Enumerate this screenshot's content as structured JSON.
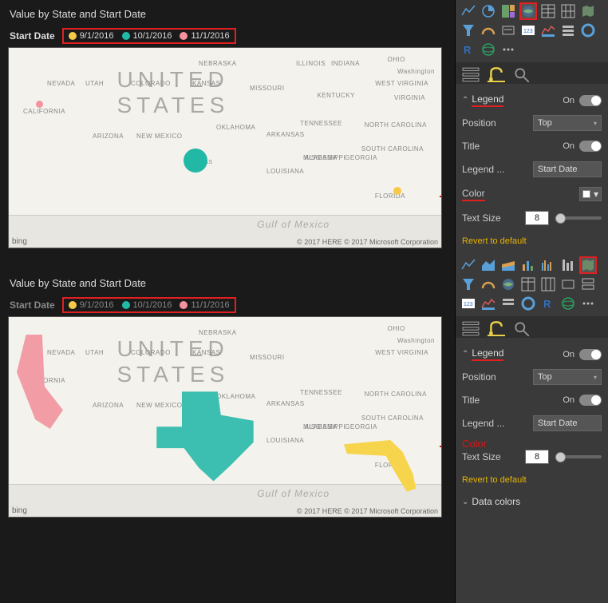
{
  "visual1": {
    "title": "Value by State and Start Date",
    "legend_label": "Start Date",
    "legend_items": [
      {
        "color": "#f7c948",
        "text": "9/1/2016"
      },
      {
        "color": "#22b8a6",
        "text": "10/1/2016"
      },
      {
        "color": "#f5929e",
        "text": "11/1/2016"
      }
    ],
    "map_label": "UNITED STATES",
    "gulf": "Gulf of Mexico",
    "bing": "bing",
    "attrib": "© 2017 HERE    © 2017 Microsoft Corporation",
    "states": {
      "ohio": "OHIO",
      "washington": "Washington",
      "wv": "WEST VIRGINIA",
      "nevada": "NEVADA",
      "utah": "UTAH",
      "colorado": "COLORADO",
      "kansas": "KANSAS",
      "missouri": "MISSOURI",
      "nebraska": "NEBRASKA",
      "illinois": "ILLINOIS",
      "indiana": "INDIANA",
      "kentucky": "KENTUCKY",
      "virginia": "VIRGINIA",
      "california": "CALIFORNIA",
      "arizona": "ARIZONA",
      "newmexico": "NEW MEXICO",
      "oklahoma": "OKLAHOMA",
      "arkansas": "ARKANSAS",
      "tennessee": "TENNESSEE",
      "northcarolina": "NORTH CAROLINA",
      "southcarolina": "SOUTH CAROLINA",
      "texas": "TEXAS",
      "louisiana": "LOUISIANA",
      "mississippi": "MISSISSIPPI",
      "alabama": "ALABAMA",
      "georgia": "GEORGIA",
      "florida": "FLORIDA"
    }
  },
  "visual2": {
    "title": "Value by State and Start Date",
    "legend_label": "Start Date",
    "legend_items": [
      {
        "color": "#f7c948",
        "text": "9/1/2016"
      },
      {
        "color": "#22b8a6",
        "text": "10/1/2016"
      },
      {
        "color": "#f5929e",
        "text": "11/1/2016"
      }
    ],
    "map_label": "UNITED STATES",
    "gulf": "Gulf of Mexico",
    "bing": "bing",
    "attrib": "© 2017 HERE    © 2017 Microsoft Corporation"
  },
  "pane1": {
    "legend_header": "Legend",
    "on": "On",
    "position_label": "Position",
    "position_value": "Top",
    "title_label": "Title",
    "legendname_label": "Legend ...",
    "legendname_value": "Start Date",
    "color_label": "Color",
    "textsize_label": "Text Size",
    "textsize_value": "8",
    "revert": "Revert to default"
  },
  "pane2": {
    "legend_header": "Legend",
    "on": "On",
    "position_label": "Position",
    "position_value": "Top",
    "title_label": "Title",
    "legendname_label": "Legend ...",
    "legendname_value": "Start Date",
    "color_label": "Color",
    "textsize_label": "Text Size",
    "textsize_value": "8",
    "revert": "Revert to default",
    "datacolors": "Data colors"
  }
}
